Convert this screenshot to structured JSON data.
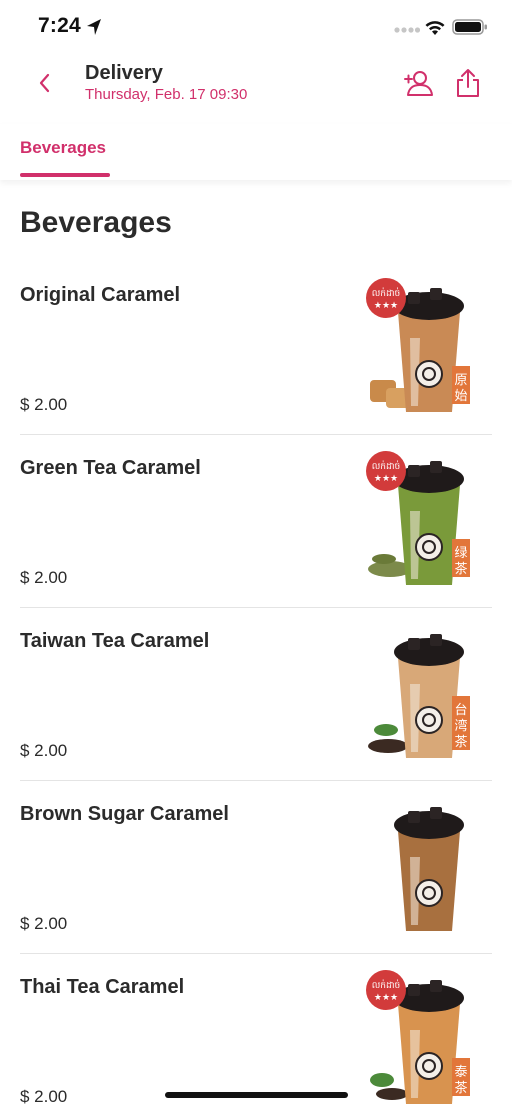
{
  "status_bar": {
    "time": "7:24"
  },
  "header": {
    "title": "Delivery",
    "subtitle": "Thursday, Feb. 17 09:30"
  },
  "tabs": [
    {
      "label": "Beverages"
    }
  ],
  "section": {
    "title": "Beverages"
  },
  "items": [
    {
      "name": "Original Caramel",
      "price": "$ 2.00",
      "badge_text": "លក់ដាច់",
      "side_text": "原始",
      "tea_color": "#c98a55",
      "garnish": "caramel"
    },
    {
      "name": "Green Tea Caramel",
      "price": "$ 2.00",
      "badge_text": "លក់ដាច់",
      "side_text": "绿茶",
      "tea_color": "#7a9a3a",
      "garnish": "leaves"
    },
    {
      "name": "Taiwan Tea Caramel",
      "price": "$ 2.00",
      "badge_text": "",
      "side_text": "台湾茶",
      "tea_color": "#d8a878",
      "garnish": "tea"
    },
    {
      "name": "Brown Sugar Caramel",
      "price": "$ 2.00",
      "badge_text": "",
      "side_text": "",
      "tea_color": "#a8703f",
      "garnish": "none"
    },
    {
      "name": "Thai Tea Caramel",
      "price": "$ 2.00",
      "badge_text": "លក់ដាច់",
      "side_text": "泰茶",
      "tea_color": "#d8934f",
      "garnish": "mint"
    }
  ],
  "colors": {
    "accent": "#d1306b",
    "text": "#2b2b2b"
  },
  "icons": [
    "location-arrow-icon",
    "wifi-icon",
    "battery-icon",
    "chevron-left-icon",
    "add-user-icon",
    "share-icon"
  ]
}
